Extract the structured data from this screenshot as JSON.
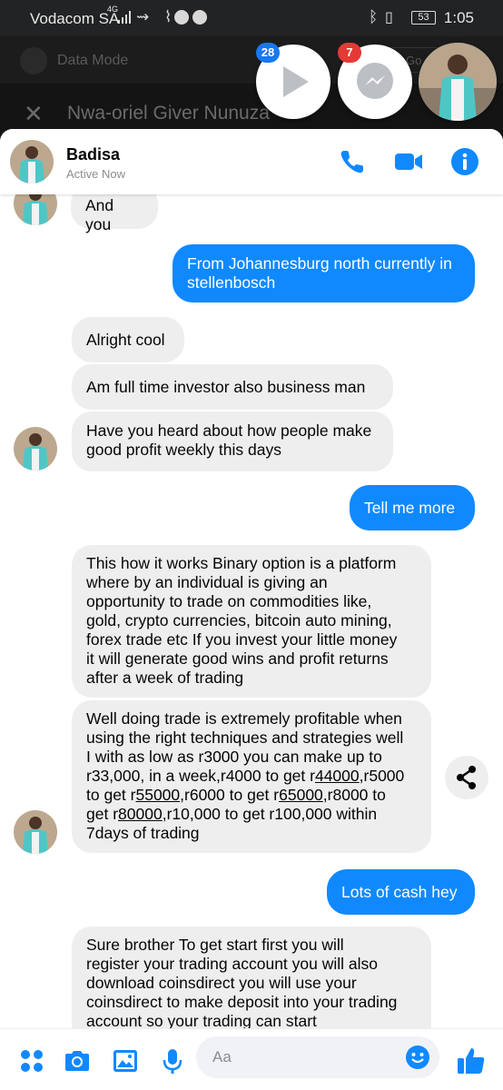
{
  "status_bar": {
    "carrier": "Vodacom SA",
    "network": "4G",
    "battery": "53",
    "time": "1:05"
  },
  "background_app": {
    "data_mode_label": "Data Mode",
    "go_label": "Go",
    "conversation_title": "Nwa-oriel Giver Nunuza"
  },
  "chat_heads": {
    "video_badge": "28",
    "messenger_badge": "7"
  },
  "chat": {
    "contact_name": "Badisa",
    "presence": "Active Now",
    "accent_color": "#1089ff"
  },
  "messages": [
    {
      "side": "in",
      "text": "And you"
    },
    {
      "side": "out",
      "lines": [
        "From Johannesburg north currently in",
        "stellenbosch"
      ]
    },
    {
      "side": "in",
      "text": "Alright cool"
    },
    {
      "side": "in",
      "text": "Am full time investor also business man"
    },
    {
      "side": "in",
      "lines": [
        "Have you heard about how people make",
        "good profit weekly this days"
      ]
    },
    {
      "side": "out",
      "text": "Tell me more"
    },
    {
      "side": "in",
      "lines": [
        "This how it works Binary option is a platform",
        "where by an individual is giving an",
        "opportunity to trade on commodities like,",
        "gold, crypto currencies, bitcoin auto mining,",
        "forex trade etc If you invest your little money",
        "it will generate good wins and profit returns",
        "after a week of trading"
      ]
    },
    {
      "side": "in",
      "line1": "Well doing trade is extremely profitable when",
      "line2": "using the right techniques and strategies well",
      "line3": "I with as low as r3000 you can make up to",
      "line4a": "r33,000, in a week,r4000 to get r",
      "line4u": "44000",
      "line4b": ",r5000",
      "line5a": "to get r",
      "line5u1": "55000",
      "line5b": ",r6000 to get r",
      "line5u2": "65000",
      "line5c": ",r8000 to",
      "line6a": "get r",
      "line6u": "80000",
      "line6b": ",r10,000 to get r100,000 within",
      "line7": "7days of trading"
    },
    {
      "side": "out",
      "text": "Lots of cash hey"
    },
    {
      "side": "in",
      "lines": [
        "Sure brother  To get start first you will",
        "register your trading account you will also",
        "download coinsdirect you will use your",
        "coinsdirect  to make deposit into your trading",
        "account so your trading can start"
      ]
    }
  ],
  "composer": {
    "placeholder": "Aa"
  },
  "icons": [
    "four-dots-icon",
    "camera-icon",
    "image-icon",
    "microphone-icon",
    "emoji-icon",
    "thumbs-up-icon",
    "phone-icon",
    "video-call-icon",
    "info-icon",
    "share-icon",
    "play-icon",
    "messenger-icon"
  ]
}
